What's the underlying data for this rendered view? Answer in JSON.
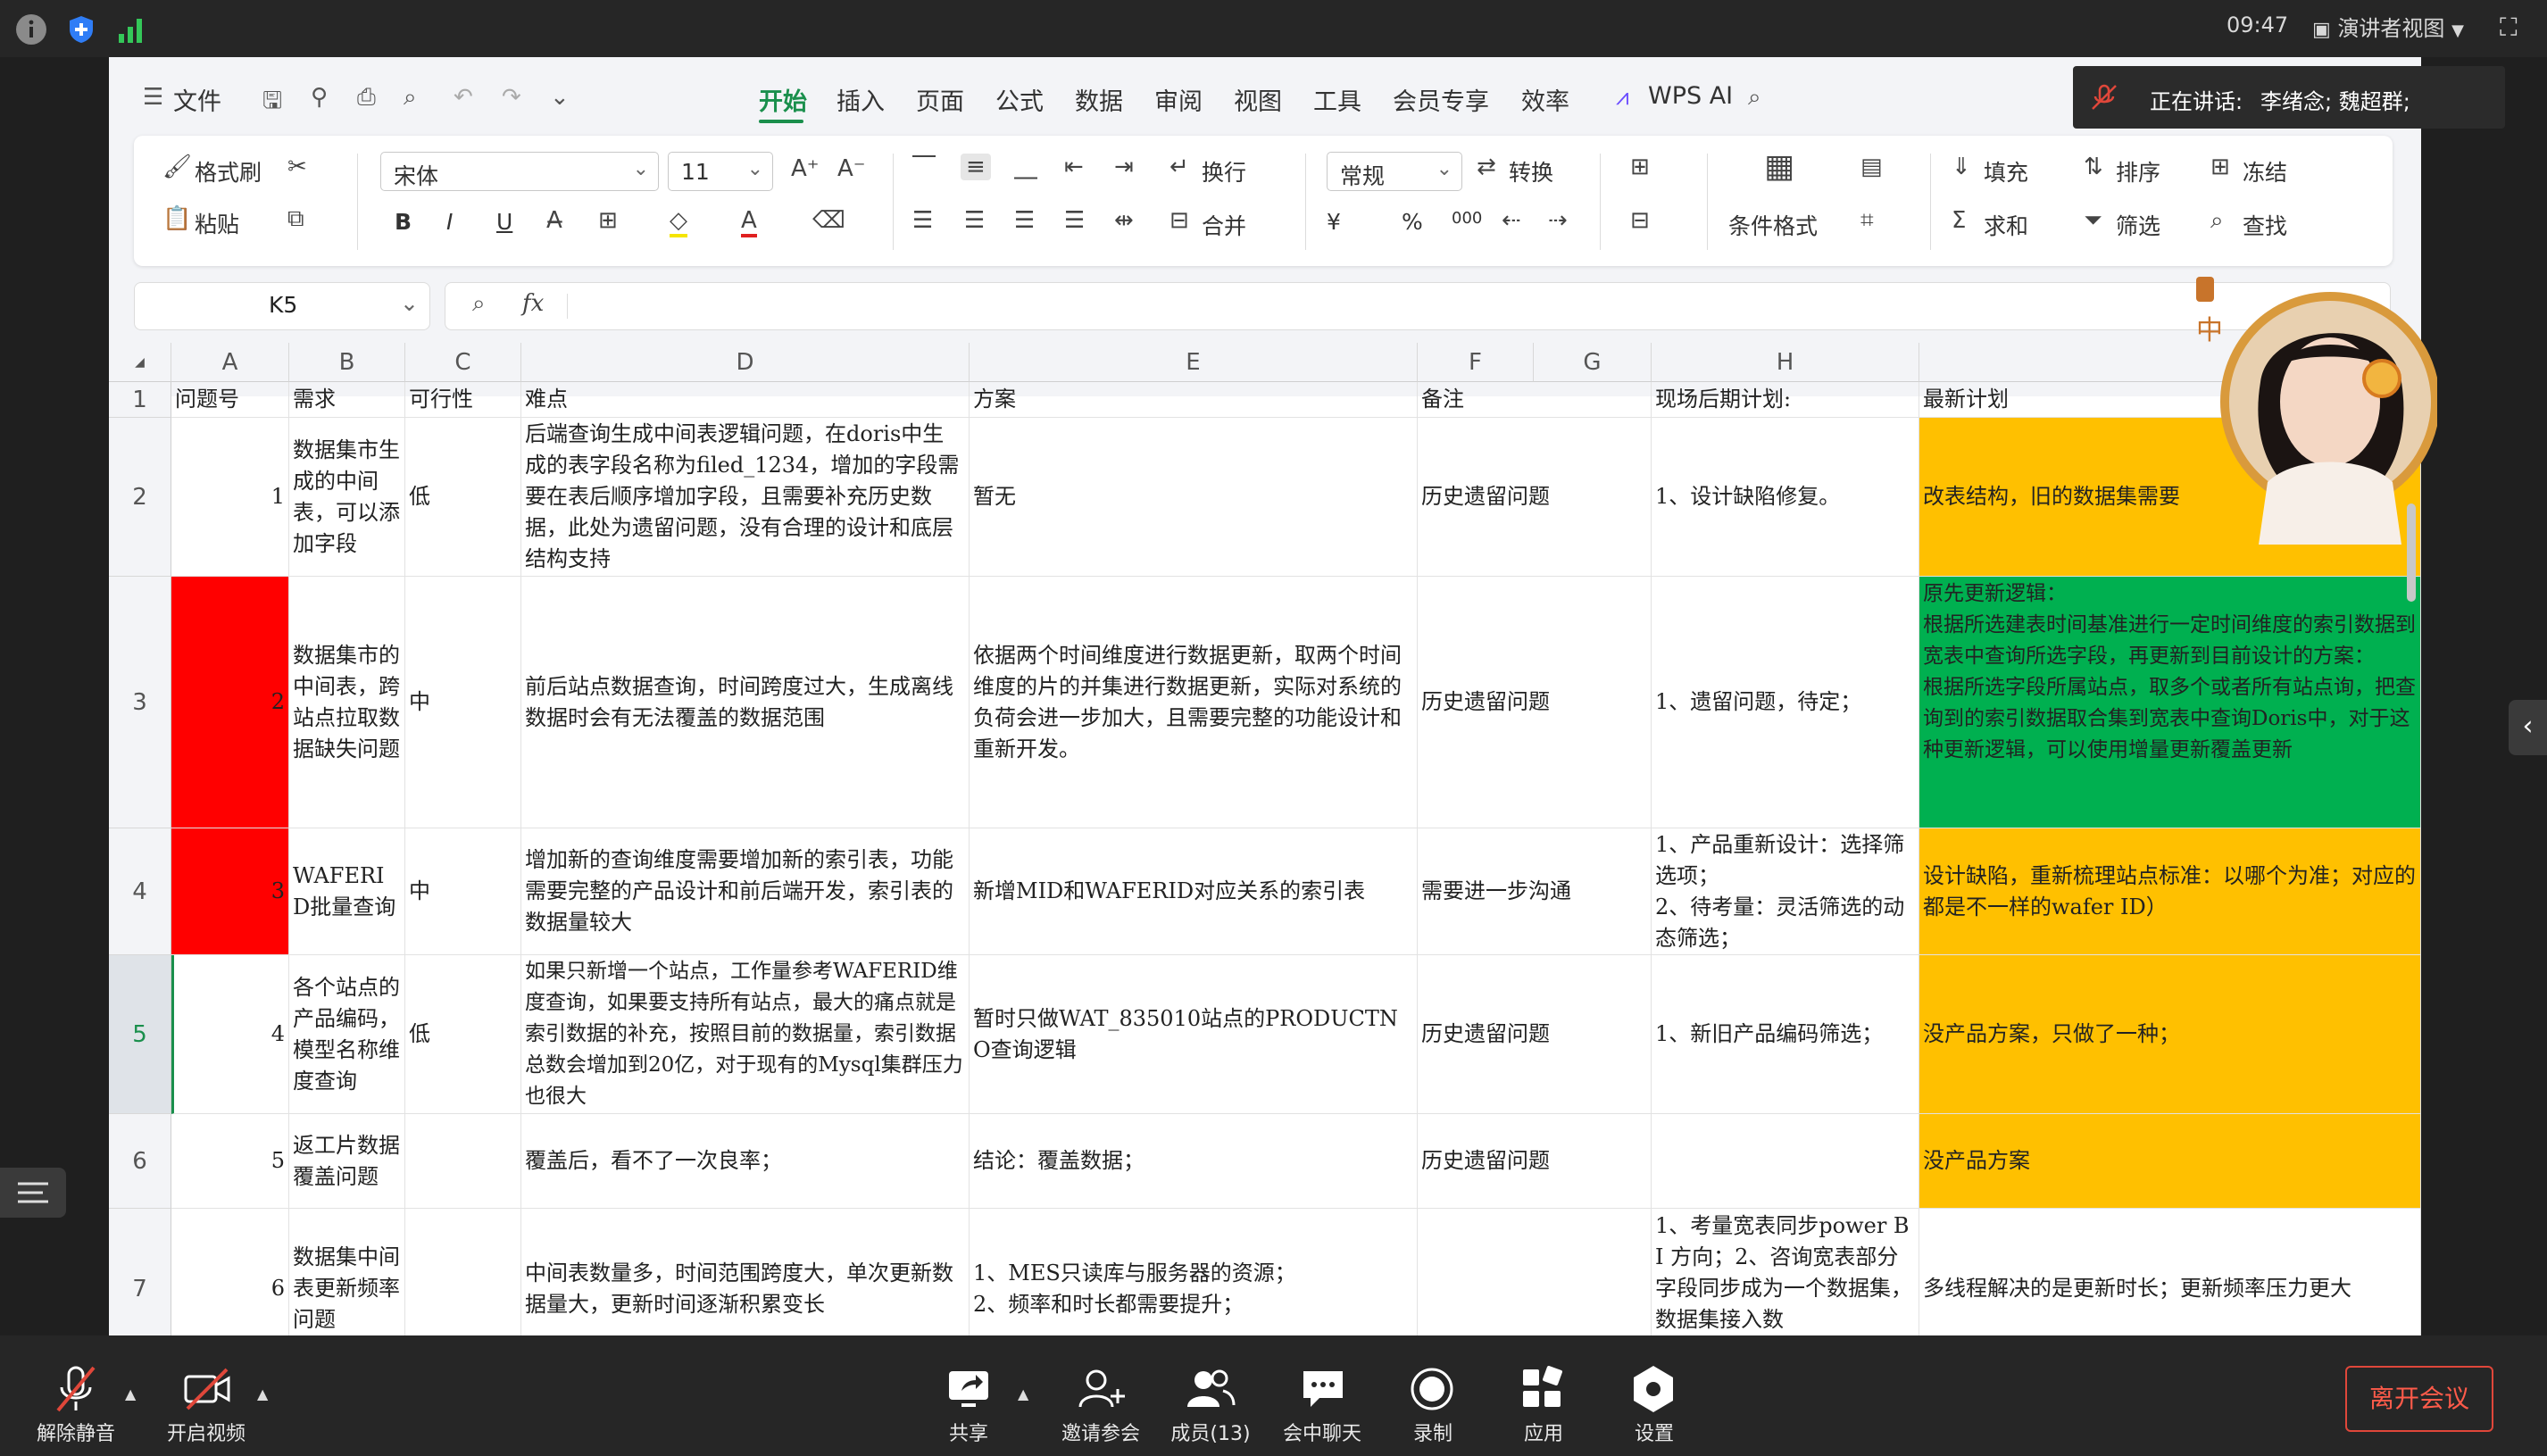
{
  "status_bar": {
    "time": "09:47",
    "view_mode": "演讲者视图"
  },
  "toolbar": {
    "file_label": "文件",
    "menus": [
      "开始",
      "插入",
      "页面",
      "公式",
      "数据",
      "审阅",
      "视图",
      "工具",
      "会员专享",
      "效率"
    ],
    "active_menu": "开始",
    "wps_ai_label": "WPS AI"
  },
  "ribbon": {
    "format_painter": "格式刷",
    "paste": "粘贴",
    "font_name": "宋体",
    "font_size": "11",
    "wrap": "换行",
    "merge": "合并",
    "number_format": "常规",
    "convert": "转换",
    "cond_format": "条件格式",
    "fill": "填充",
    "sort": "排序",
    "freeze": "冻结",
    "sum": "求和",
    "filter": "筛选",
    "find": "查找",
    "bold": "B",
    "italic": "I",
    "underline": "U",
    "currency": "¥",
    "percent": "%",
    "thousands": "000"
  },
  "formula_bar": {
    "cell_ref": "K5",
    "fx": "fx"
  },
  "sheet": {
    "columns": [
      "A",
      "B",
      "C",
      "D",
      "E",
      "F",
      "G",
      "H"
    ],
    "rows": [
      {
        "num": "1",
        "A": "问题号",
        "B": "需求",
        "C": "可行性",
        "D": "难点",
        "E": "方案",
        "F": "备注",
        "G": "",
        "H": "现场后期计划:",
        "I": "最新计划"
      },
      {
        "num": "2",
        "A": "1",
        "B": "数据集市生成的中间表，可以添加字段",
        "C": "低",
        "D": "后端查询生成中间表逻辑问题，在doris中生成的表字段名称为filed_1234，增加的字段需要在表后顺序增加字段，且需要补充历史数据，此处为遗留问题，没有合理的设计和底层结构支持",
        "E": "暂无",
        "F": "历史遗留问题",
        "G": "",
        "H": "1、设计缺陷修复。",
        "I": "改表结构，旧的数据集需要"
      },
      {
        "num": "3",
        "A": "2",
        "B": "数据集市的中间表，跨站点拉取数据缺失问题",
        "C": "中",
        "D": "前后站点数据查询，时间跨度过大，生成离线数据时会有无法覆盖的数据范围",
        "E": "依据两个时间维度进行数据更新，取两个时间维度的片的并集进行数据更新，实际对系统的负荷会进一步加大，且需要完整的功能设计和重新开发。",
        "F": "历史遗留问题",
        "G": "",
        "H": "1、遗留问题，待定；",
        "I": "原先更新逻辑：\n根据所选建表时间基准进行一定时间维度的索引数据到宽表中查询所选字段，再更新到目前设计的方案：\n根据所选字段所属站点，取多个或者所有站点询，把查询到的索引数据取合集到宽表中查询Doris中，对于这种更新逻辑，可以使用增量更新覆盖更新"
      },
      {
        "num": "4",
        "A": "3",
        "B": "WAFERID批量查询",
        "C": "中",
        "D": "增加新的查询维度需要增加新的索引表，功能需要完整的产品设计和前后端开发，索引表的数据量较大",
        "E": "新增MID和WAFERID对应关系的索引表",
        "F": "需要进一步沟通",
        "G": "",
        "H": "1、产品重新设计：选择筛选项；\n2、待考量：灵活筛选的动态筛选；",
        "I": "设计缺陷，重新梳理站点标准：以哪个为准；对应的都是不一样的wafer ID）"
      },
      {
        "num": "5",
        "A": "4",
        "B": "各个站点的产品编码，模型名称维度查询",
        "C": "低",
        "D": "如果只新增一个站点，工作量参考WAFERID维度查询，如果要支持所有站点，最大的痛点就是索引数据的补充，按照目前的数据量，索引数据总数会增加到20亿，对于现有的Mysql集群压力也很大",
        "E": "暂时只做WAT_835010站点的PRODUCTNO查询逻辑",
        "F": "历史遗留问题",
        "G": "",
        "H": "1、新旧产品编码筛选；",
        "I": "没产品方案，只做了一种；"
      },
      {
        "num": "6",
        "A": "5",
        "B": "返工片数据覆盖问题",
        "C": "",
        "D": "覆盖后，看不了一次良率；",
        "E": "结论：覆盖数据；",
        "F": "历史遗留问题",
        "G": "",
        "H": "",
        "I": "没产品方案"
      },
      {
        "num": "7",
        "A": "6",
        "B": "数据集中间表更新频率问题",
        "C": "",
        "D": "中间表数量多，时间范围跨度大，单次更新数据量大，更新时间逐渐积累变长",
        "E": "1、MES只读库与服务器的资源；\n2、频率和时长都需要提升；",
        "F": "",
        "G": "",
        "H": "1、考量宽表同步power BI 方向；2、咨询宽表部分字段同步成为一个数据集，数据集接入数",
        "I": "多线程解决的是更新时长；更新频率压力更大"
      }
    ]
  },
  "meeting": {
    "speaking_label": "正在讲话:",
    "speakers": "李绪念; 魏超群;",
    "buttons": [
      "解除静音",
      "开启视频",
      "共享",
      "邀请参会",
      "成员(13)",
      "会中聊天",
      "录制",
      "应用",
      "设置"
    ],
    "leave": "离开会议"
  },
  "colors": {
    "red": "#ff0000",
    "green": "#00b050",
    "orange": "#ffc000",
    "accent": "#1a8f4c"
  }
}
